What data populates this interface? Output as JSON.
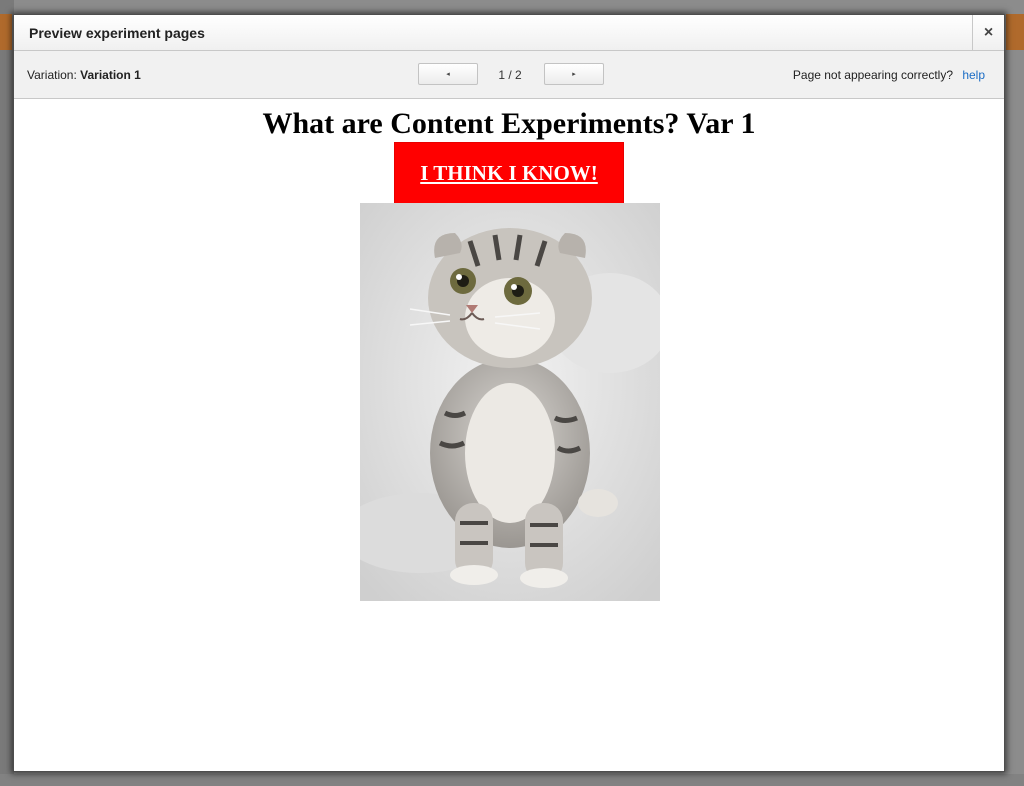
{
  "modal": {
    "title": "Preview experiment pages",
    "close_symbol": "×"
  },
  "toolbar": {
    "variation_label": "Variation:",
    "variation_value": "Variation 1",
    "prev_symbol": "◂",
    "next_symbol": "▸",
    "page_counter": "1 / 2",
    "problem_text": "Page not appearing correctly?",
    "help_label": "help"
  },
  "preview": {
    "heading": "What are Content Experiments? Var 1",
    "cta_label": "I THINK I KNOW!",
    "image_subject": "kitten"
  },
  "colors": {
    "cta_background": "#ff0000",
    "help_link": "#1a6cc5"
  }
}
